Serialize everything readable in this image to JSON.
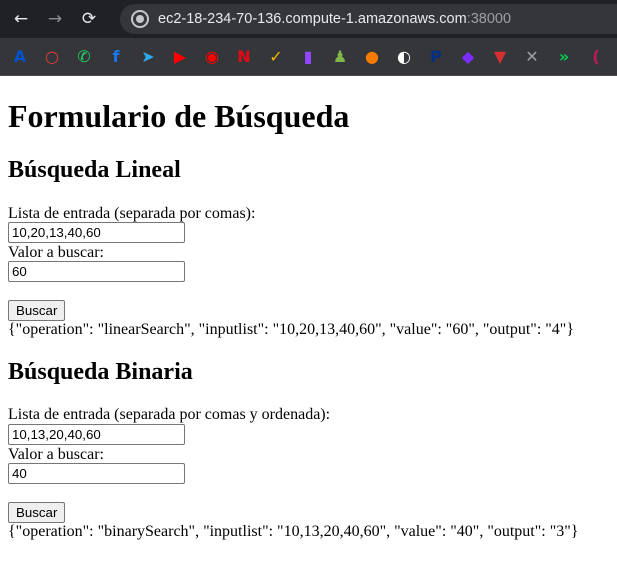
{
  "browser": {
    "url_host": "ec2-18-234-70-136.compute-1.amazonaws.com",
    "url_port": ":38000",
    "back_glyph": "←",
    "forward_glyph": "→",
    "reload_glyph": "⟳",
    "bookmarks": [
      {
        "icon": "atlassian-icon",
        "color": "#0052cc",
        "glyph": "A"
      },
      {
        "icon": "ring-icon",
        "color": "#e53935",
        "glyph": "○"
      },
      {
        "icon": "whatsapp-icon",
        "color": "#25d366",
        "glyph": "✆"
      },
      {
        "icon": "facebook-icon",
        "color": "#1877f2",
        "glyph": "f"
      },
      {
        "icon": "telegram-icon",
        "color": "#2aabee",
        "glyph": "➤"
      },
      {
        "icon": "youtube-icon",
        "color": "#ff0000",
        "glyph": "▶"
      },
      {
        "icon": "youtube-music-icon",
        "color": "#ff0000",
        "glyph": "◉"
      },
      {
        "icon": "netflix-icon",
        "color": "#e50914",
        "glyph": "N"
      },
      {
        "icon": "yellow-app-icon",
        "color": "#f4b400",
        "glyph": "✓"
      },
      {
        "icon": "twitch-icon",
        "color": "#9146ff",
        "glyph": "▮"
      },
      {
        "icon": "chess-icon",
        "color": "#81b64c",
        "glyph": "♟"
      },
      {
        "icon": "orange-ball-icon",
        "color": "#f57c00",
        "glyph": "●"
      },
      {
        "icon": "globe-icon",
        "color": "#ffffff",
        "glyph": "◐"
      },
      {
        "icon": "paypal-icon",
        "color": "#003087",
        "glyph": "P"
      },
      {
        "icon": "diamond-app-icon",
        "color": "#7b2cff",
        "glyph": "◆"
      },
      {
        "icon": "shield-icon",
        "color": "#d32f2f",
        "glyph": "▼"
      },
      {
        "icon": "tools-icon",
        "color": "#9aa0a6",
        "glyph": "✕"
      },
      {
        "icon": "chevron-app-icon",
        "color": "#00c853",
        "glyph": "»"
      },
      {
        "icon": "partial-app-icon",
        "color": "#c2185b",
        "glyph": "("
      }
    ]
  },
  "page": {
    "title": "Formulario de Búsqueda",
    "linear": {
      "heading": "Búsqueda Lineal",
      "list_label": "Lista de entrada (separada por comas):",
      "list_value": "10,20,13,40,60",
      "value_label": "Valor a buscar:",
      "value_value": "60",
      "button_label": "Buscar",
      "result": "{\"operation\": \"linearSearch\", \"inputlist\": \"10,20,13,40,60\", \"value\": \"60\", \"output\": \"4\"}"
    },
    "binary": {
      "heading": "Búsqueda Binaria",
      "list_label": "Lista de entrada (separada por comas y ordenada):",
      "list_value": "10,13,20,40,60",
      "value_label": "Valor a buscar:",
      "value_value": "40",
      "button_label": "Buscar",
      "result": "{\"operation\": \"binarySearch\", \"inputlist\": \"10,13,20,40,60\", \"value\": \"40\", \"output\": \"3\"}"
    }
  }
}
